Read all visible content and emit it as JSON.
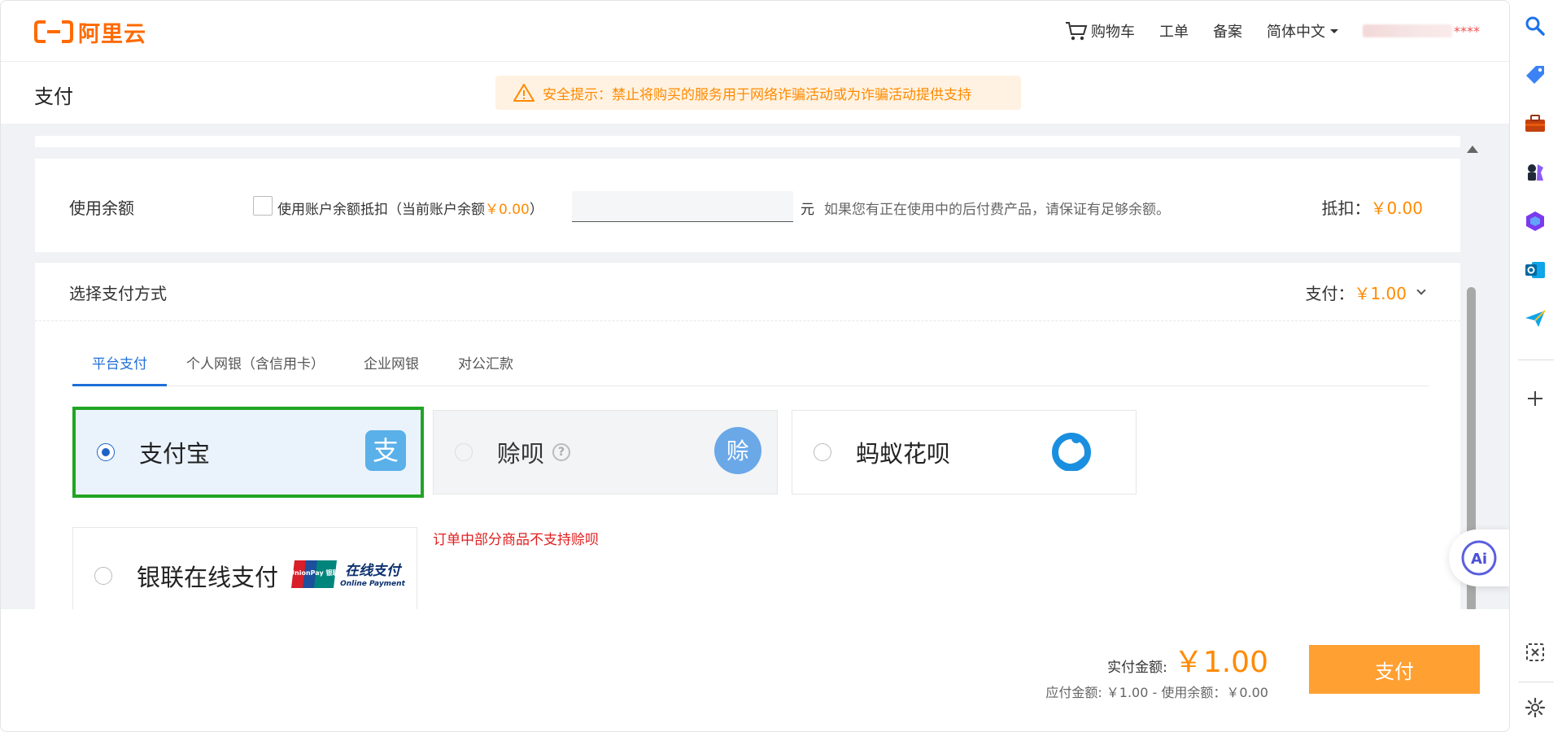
{
  "header": {
    "logo_text": "阿里云",
    "nav": {
      "cart": "购物车",
      "ticket": "工单",
      "filing": "备案",
      "language": "简体中文",
      "user_masked": "****"
    }
  },
  "subheader": {
    "title": "支付",
    "warning": "安全提示：禁止将购买的服务用于网络诈骗活动或为诈骗活动提供支持"
  },
  "balance": {
    "title": "使用余额",
    "checkbox_label": "使用账户余额抵扣（当前账户余额",
    "current_balance": "￥0.00",
    "checkbox_label_close": "）",
    "input_value": "",
    "unit": "元",
    "tip": "如果您有正在使用中的后付费产品，请保证有足够余额。",
    "deduct_label": "抵扣：",
    "deduct_value": "￥0.00"
  },
  "payment": {
    "title": "选择支付方式",
    "amount_label": "支付：",
    "amount_value": "￥1.00",
    "tabs": [
      "平台支付",
      "个人网银（含信用卡）",
      "企业网银",
      "对公汇款"
    ],
    "active_tab": 0,
    "methods": [
      {
        "label": "支付宝",
        "icon": "alipay-icon",
        "selected": true
      },
      {
        "label": "赊呗",
        "icon": "shebei-icon",
        "disabled": true
      },
      {
        "label": "蚂蚁花呗",
        "icon": "huabei-icon"
      },
      {
        "label": "银联在线支付",
        "icon": "unionpay-icon"
      }
    ],
    "shebei_error": "订单中部分商品不支持赊呗",
    "unionpay_logo_text": "UnionPay 银联",
    "unionpay_online_cn": "在线支付",
    "unionpay_online_en": "Online Payment",
    "alipay_glyph": "支",
    "shebei_glyph": "赊"
  },
  "footer": {
    "actual_label": "实付金额:",
    "actual_value": "￥1.00",
    "breakdown": "应付金额: ￥1.00 - 使用余额：￥0.00",
    "pay_button": "支付"
  },
  "ai_button_label": "Ai",
  "colors": {
    "brand_orange": "#ff6a00",
    "price_orange": "#ff8a00",
    "active_blue": "#1f6fd8",
    "selected_green": "#21a524",
    "error_red": "#e02020",
    "pay_button": "#ffa033"
  },
  "sidebar_icons": [
    "search-icon",
    "tag-icon",
    "toolbox-icon",
    "chess-icon",
    "copilot-icon",
    "outlook-icon",
    "send-icon",
    "add-icon",
    "screenshot-icon",
    "settings-icon"
  ]
}
